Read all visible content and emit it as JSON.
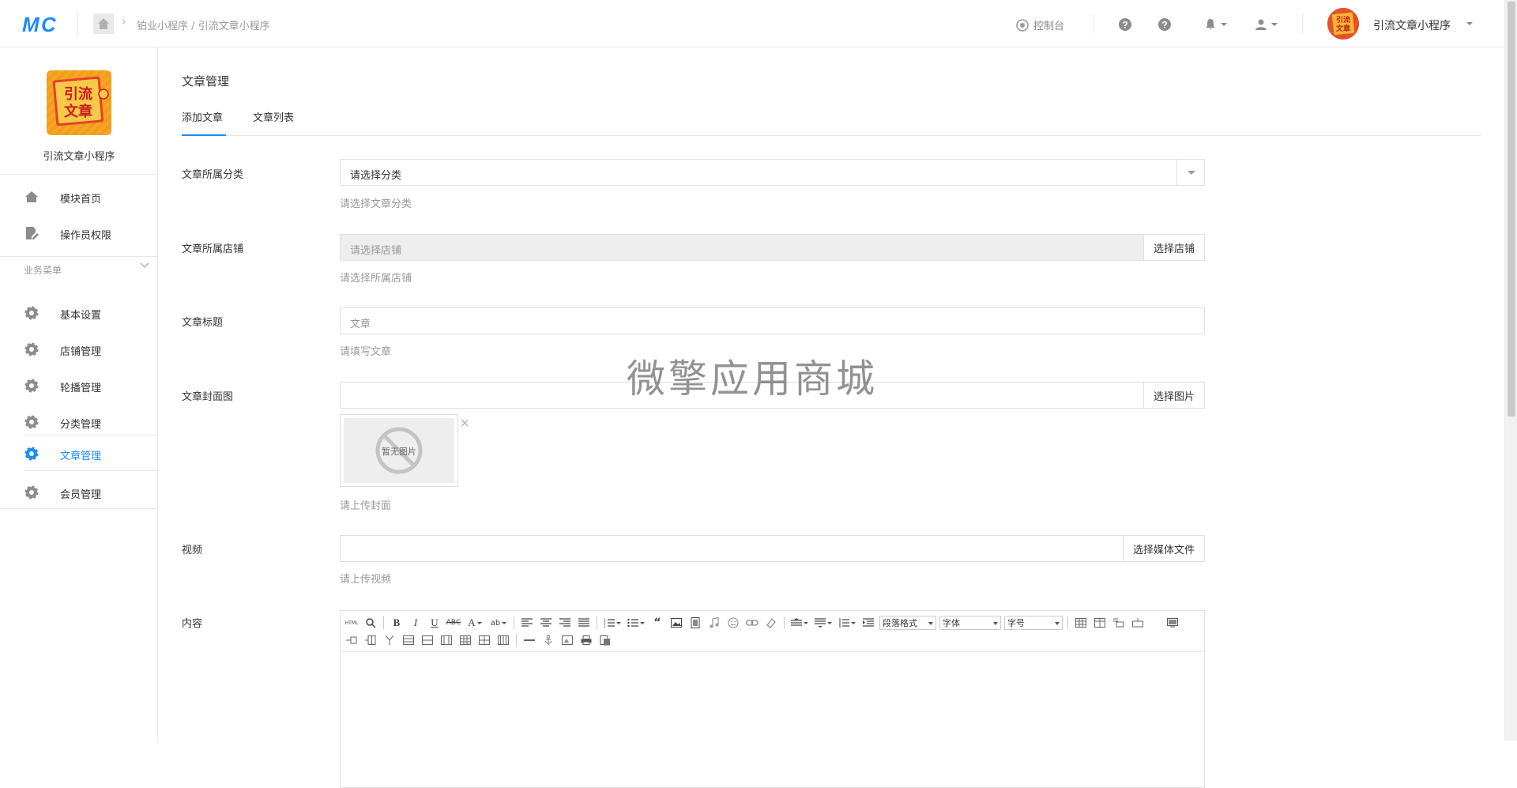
{
  "header": {
    "logo_text": "MC",
    "breadcrumb": {
      "part1": "铂业小程序",
      "separator": " / ",
      "part2": "引流文章小程序"
    },
    "console_label": "控制台",
    "user_name": "引流文章小程序",
    "avatar_text": "引流文章"
  },
  "sidebar": {
    "app_name": "引流文章小程序",
    "logo_text": {
      "line1": "引流",
      "line2": "文章"
    },
    "top_items": [
      {
        "label": "模块首页",
        "icon": "home-icon"
      },
      {
        "label": "操作员权限",
        "icon": "edit-doc-icon"
      }
    ],
    "section_title": "业务菜单",
    "business_items": [
      {
        "label": "基本设置",
        "icon": "gear-icon"
      },
      {
        "label": "店铺管理",
        "icon": "gear-icon"
      },
      {
        "label": "轮播管理",
        "icon": "gear-icon"
      },
      {
        "label": "分类管理",
        "icon": "gear-icon"
      },
      {
        "label": "文章管理",
        "icon": "gear-icon",
        "active": true
      },
      {
        "label": "会员管理",
        "icon": "gear-icon"
      }
    ],
    "accent_color": "#1a8cff"
  },
  "main": {
    "page_title": "文章管理",
    "tabs": [
      {
        "label": "添加文章",
        "active": true
      },
      {
        "label": "文章列表",
        "active": false
      }
    ],
    "form": {
      "category": {
        "label": "文章所属分类",
        "value": "请选择分类",
        "help": "请选择文章分类"
      },
      "store": {
        "label": "文章所属店铺",
        "placeholder": "请选择店铺",
        "button": "选择店铺",
        "help": "请选择所属店铺"
      },
      "title": {
        "label": "文章标题",
        "placeholder": "文章",
        "help": "请填写文章"
      },
      "cover": {
        "label": "文章封面图",
        "value": "",
        "button": "选择图片",
        "no_image": "暂无图片",
        "close": "×",
        "help": "请上传封面"
      },
      "video": {
        "label": "视频",
        "value": "",
        "button": "选择媒体文件",
        "help": "请上传视频"
      },
      "content": {
        "label": "内容",
        "toolbar": {
          "html_label": "HTML",
          "paragraph_select": "段落格式",
          "font_select": "字体",
          "size_select": "字号"
        }
      }
    }
  },
  "watermark": "微擎应用商城"
}
